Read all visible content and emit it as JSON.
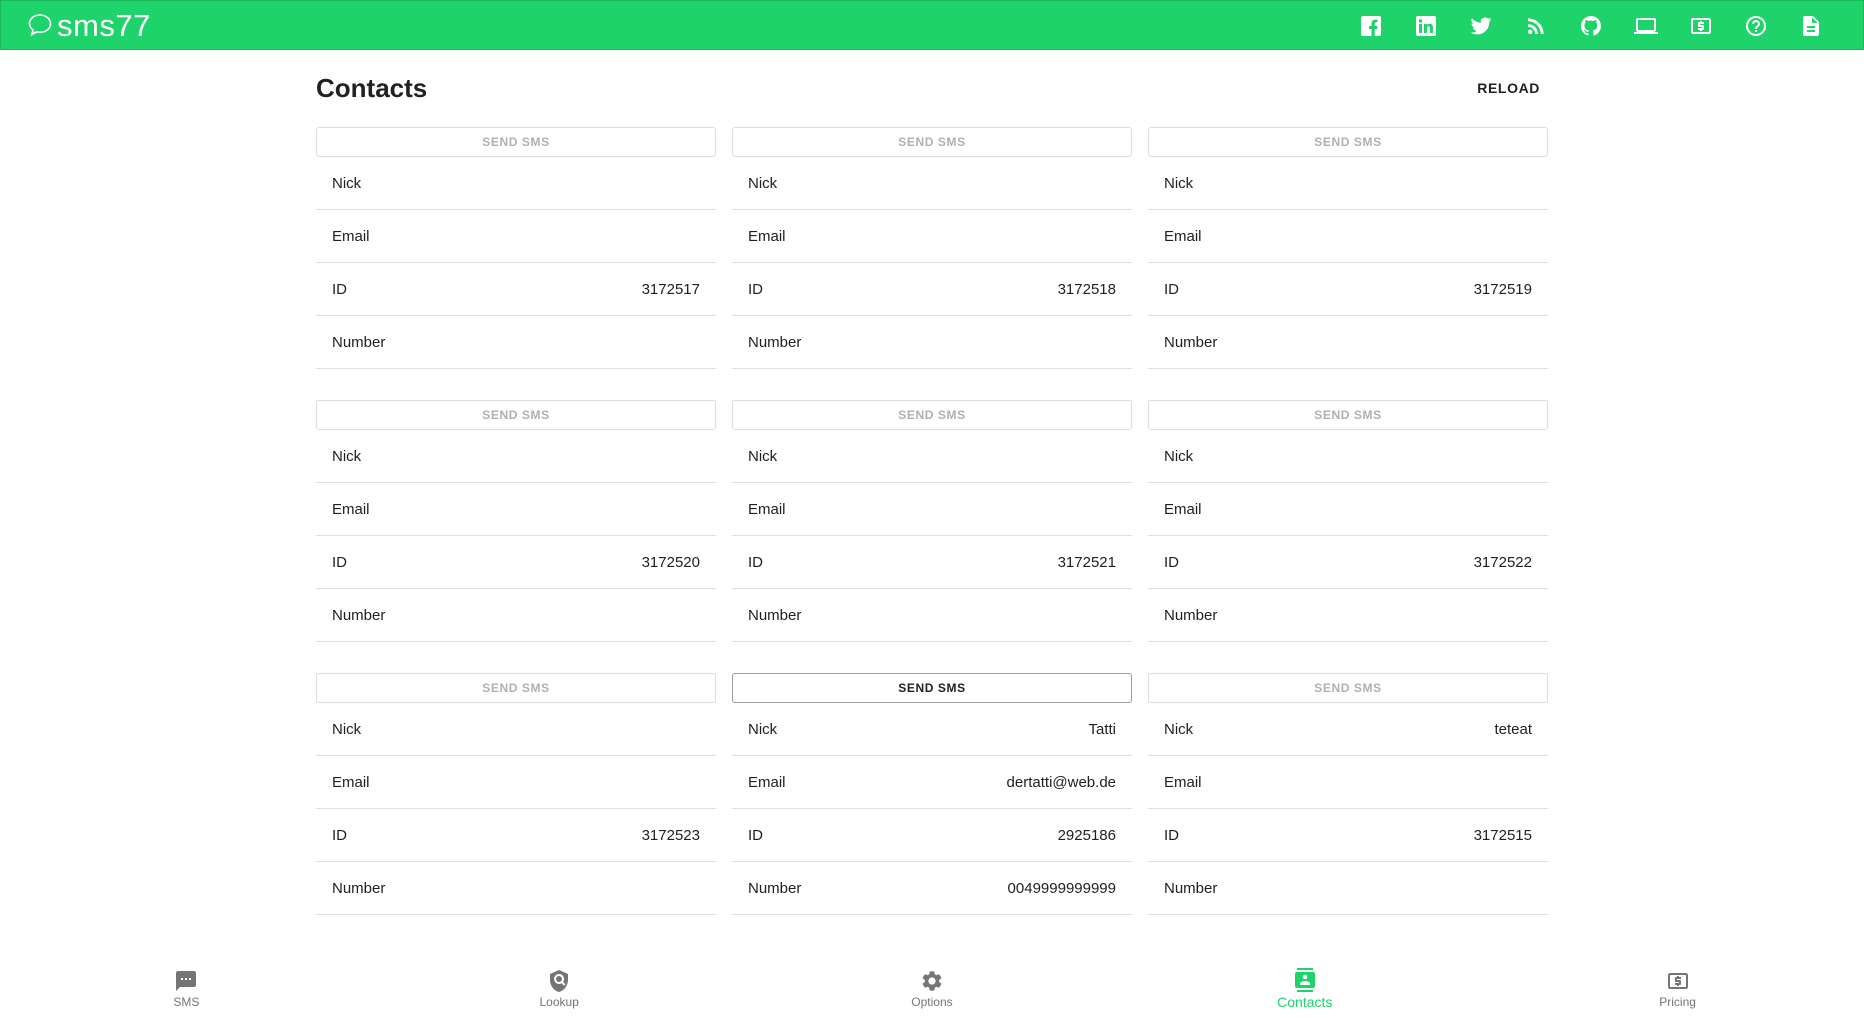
{
  "app": {
    "brand": "sms77",
    "accent": "#1ed36a"
  },
  "topbar": {
    "icons": [
      "facebook-icon",
      "linkedin-icon",
      "twitter-icon",
      "rss-icon",
      "github-icon",
      "laptop-icon",
      "dollar-icon",
      "help-icon",
      "document-icon"
    ]
  },
  "page": {
    "title": "Contacts",
    "reload_label": "RELOAD"
  },
  "labels": {
    "send_sms": "SEND SMS",
    "nick": "Nick",
    "email": "Email",
    "id": "ID",
    "number": "Number"
  },
  "contacts": [
    {
      "nick": "",
      "email": "",
      "id": "3172517",
      "number": "",
      "send_enabled": false
    },
    {
      "nick": "",
      "email": "",
      "id": "3172518",
      "number": "",
      "send_enabled": false
    },
    {
      "nick": "",
      "email": "",
      "id": "3172519",
      "number": "",
      "send_enabled": false
    },
    {
      "nick": "",
      "email": "",
      "id": "3172520",
      "number": "",
      "send_enabled": false
    },
    {
      "nick": "",
      "email": "",
      "id": "3172521",
      "number": "",
      "send_enabled": false
    },
    {
      "nick": "",
      "email": "",
      "id": "3172522",
      "number": "",
      "send_enabled": false
    },
    {
      "nick": "",
      "email": "",
      "id": "3172523",
      "number": "",
      "send_enabled": false
    },
    {
      "nick": "Tatti",
      "email": "dertatti@web.de",
      "id": "2925186",
      "number": "0049999999999",
      "send_enabled": true
    },
    {
      "nick": "teteat",
      "email": "",
      "id": "3172515",
      "number": "",
      "send_enabled": false
    }
  ],
  "bottom_nav": {
    "items": [
      {
        "label": "SMS",
        "icon": "message-icon",
        "active": false
      },
      {
        "label": "Lookup",
        "icon": "lookup-icon",
        "active": false
      },
      {
        "label": "Options",
        "icon": "gear-icon",
        "active": false
      },
      {
        "label": "Contacts",
        "icon": "contacts-icon",
        "active": true
      },
      {
        "label": "Pricing",
        "icon": "pricing-icon",
        "active": false
      }
    ]
  }
}
